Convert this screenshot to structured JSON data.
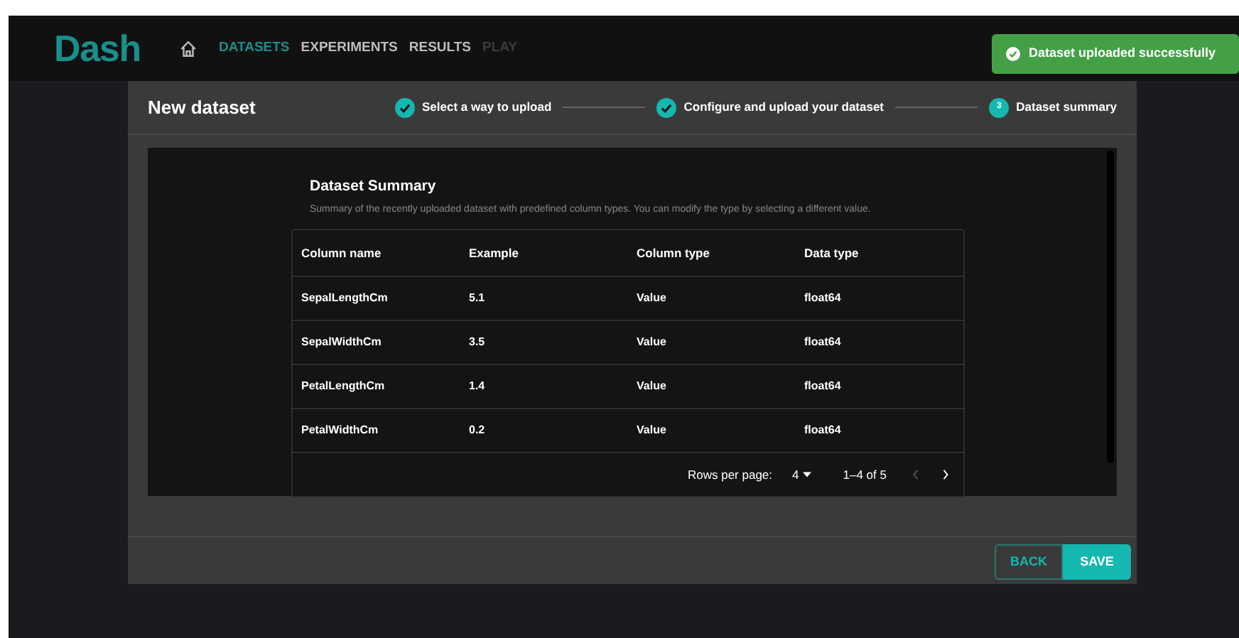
{
  "logo": "Dash",
  "nav": [
    {
      "label": "DATASETS",
      "selected": true,
      "disabled": false
    },
    {
      "label": "EXPERIMENTS",
      "selected": false,
      "disabled": false
    },
    {
      "label": "RESULTS",
      "selected": false,
      "disabled": false
    },
    {
      "label": "PLAY",
      "selected": false,
      "disabled": true
    }
  ],
  "toast": {
    "message": "Dataset uploaded successfully"
  },
  "dialog": {
    "title": "New dataset",
    "steps": [
      {
        "label": "Select a way to upload",
        "completed": true
      },
      {
        "label": "Configure and upload your dataset",
        "completed": true
      },
      {
        "label": "Dataset summary",
        "completed": false,
        "number": "3"
      }
    ],
    "summary_title": "Dataset Summary",
    "summary_description": "Summary of the recently uploaded dataset with predefined column types. You can modify the type by selecting a different value.",
    "table": {
      "columns": [
        "Column name",
        "Example",
        "Column type",
        "Data type"
      ],
      "rows": [
        [
          "SepalLengthCm",
          "5.1",
          "Value",
          "float64"
        ],
        [
          "SepalWidthCm",
          "3.5",
          "Value",
          "float64"
        ],
        [
          "PetalLengthCm",
          "1.4",
          "Value",
          "float64"
        ],
        [
          "PetalWidthCm",
          "0.2",
          "Value",
          "float64"
        ]
      ]
    },
    "pagination": {
      "rows_per_page_label": "Rows per page:",
      "rows_per_page": "4",
      "range": "1–4 of 5",
      "previous_disabled": true,
      "next_disabled": false
    },
    "buttons": [
      {
        "label": "BACK",
        "kind": "outlined"
      },
      {
        "label": "SAVE",
        "kind": "filled"
      }
    ]
  }
}
